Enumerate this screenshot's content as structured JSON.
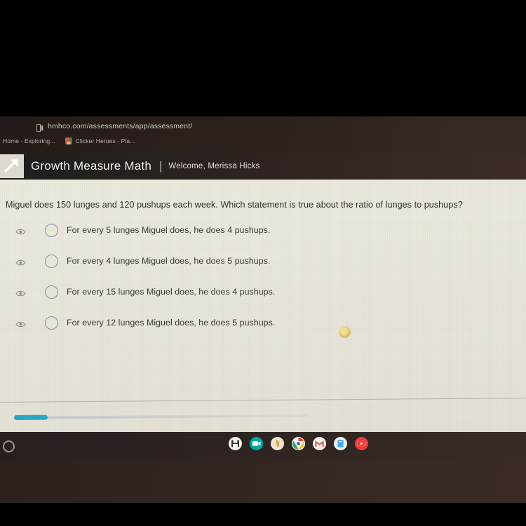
{
  "browser": {
    "url": "hmhco.com/assessments/app/assessment/",
    "url_icon": "page-icon",
    "bookmarks": [
      {
        "label": "Home - Exploring...",
        "icon": "bookmark-favicon"
      },
      {
        "label": "Clicker Heroes - Pla...",
        "icon": "clicker-heroes-favicon"
      }
    ]
  },
  "app_header": {
    "logo_icon": "hmh-arrow-logo",
    "title": "Growth Measure Math",
    "separator": "|",
    "welcome": "Welcome, Merissa Hicks"
  },
  "assessment": {
    "question": "Miguel does 150 lunges and 120 pushups each week. Which statement is true about the ratio of lunges to pushups?",
    "options": [
      {
        "id": "option-a",
        "eye_icon": "eye-icon",
        "radio_icon": "radio-unselected",
        "label": "For every 5 lunges Miguel does, he does 4 pushups.",
        "selected": false
      },
      {
        "id": "option-b",
        "eye_icon": "eye-icon",
        "radio_icon": "radio-unselected",
        "label": "For every 4 lunges Miguel does, he does 5 pushups.",
        "selected": false
      },
      {
        "id": "option-c",
        "eye_icon": "eye-icon",
        "radio_icon": "radio-unselected",
        "label": "For every 15 lunges Miguel does, he does 4 pushups.",
        "selected": false
      },
      {
        "id": "option-d",
        "eye_icon": "eye-icon",
        "radio_icon": "radio-unselected",
        "label": "For every 12 lunges Miguel does, he does 5 pushups.",
        "selected": false
      }
    ],
    "badge_icon": "gold-circle-badge",
    "progress": {
      "fill_color": "#2aa5c4",
      "percent": 11
    }
  },
  "shelf": {
    "launcher_icon": "launcher-circle-icon",
    "icons": [
      {
        "name": "files-icon"
      },
      {
        "name": "google-meet-icon"
      },
      {
        "name": "tan-app-icon"
      },
      {
        "name": "chrome-icon"
      },
      {
        "name": "gmail-icon"
      },
      {
        "name": "keep-icon"
      },
      {
        "name": "youtube-icon"
      }
    ]
  },
  "colors": {
    "accent": "#2aa5c4",
    "page_bg": "#e9e6dc",
    "header_bg": "#2a2321",
    "radio_border": "#7f93a6"
  }
}
